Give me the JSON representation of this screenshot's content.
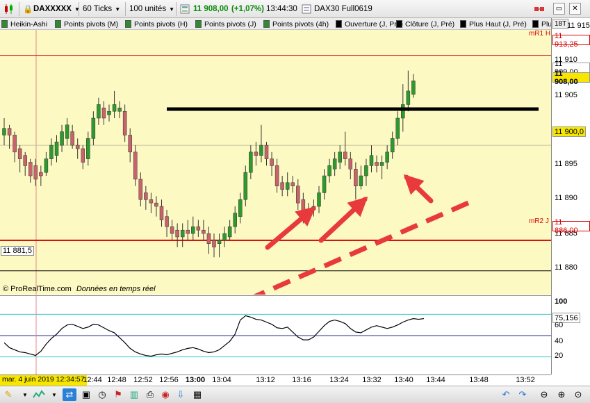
{
  "toolbar": {
    "symbol": "DAXXXXX",
    "ticks": "60 Ticks",
    "units": "100 unités",
    "price": "11 908,00",
    "change": "(+1,07%)",
    "time": "13:44:30",
    "contract": "DAX30 Full0619"
  },
  "indicators": [
    {
      "label": "Heikin-Ashi",
      "color": "#2e8b2e"
    },
    {
      "label": "Points pivots (M)",
      "color": "#2e8b2e"
    },
    {
      "label": "Points pivots (H)",
      "color": "#2e8b2e"
    },
    {
      "label": "Points pivots (J)",
      "color": "#2e8b2e"
    },
    {
      "label": "Points pivots (4h)",
      "color": "#2e8b2e"
    },
    {
      "label": "Ouverture (J, Pré)",
      "color": "#000000"
    },
    {
      "label": "Clôture (J, Pré)",
      "color": "#000000"
    },
    {
      "label": "Plus Haut (J, Pré)",
      "color": "#000000"
    },
    {
      "label": "Plu",
      "color": "#000000"
    }
  ],
  "price_pane": {
    "mr1_label": "mR1 H",
    "mr2_label": "mR2 J",
    "left_level": "11 881,5",
    "copyright": "© ProRealTime.com",
    "realtime": "Données en temps réel",
    "ticks_badge": "18T"
  },
  "price_axis": {
    "labels": [
      "11 915",
      "11 910",
      "11 905",
      "11 895",
      "11 890",
      "11 885",
      "11 880"
    ],
    "mr1_value": "11 913,25",
    "current_prev": "11 909,00",
    "current": "11 908,00",
    "level_11900": "11 900,0",
    "mr2_value": "11 886,00"
  },
  "osc_axis": {
    "labels": [
      "100",
      "60",
      "40",
      "20"
    ],
    "value": "75,156"
  },
  "time_axis": {
    "cursor_label": "mar. 4 juin 2019 12:34:57",
    "labels": [
      "12:44",
      "12:48",
      "12:52",
      "12:56",
      "13:00",
      "13:04",
      "13:12",
      "13:16",
      "13:24",
      "13:32",
      "13:40",
      "13:44",
      "13:48",
      "13:52"
    ]
  },
  "colors": {
    "bull": "#2e9a2e",
    "bear": "#c8636b",
    "pivot_line": "#d40000",
    "annot_red": "#e8393c",
    "pane_bg": "#fdf9c3"
  },
  "chart_data": {
    "type": "candlestick",
    "series_name": "Heikin-Ashi",
    "price_range": [
      11878,
      11917
    ],
    "candles": [
      {
        "o": 11901.5,
        "c": 11902.5,
        "h": 11904,
        "l": 11900
      },
      {
        "o": 11902.5,
        "c": 11901.5,
        "h": 11903,
        "l": 11899.5
      },
      {
        "o": 11901.5,
        "c": 11899,
        "h": 11902,
        "l": 11897.5
      },
      {
        "o": 11899.5,
        "c": 11898,
        "h": 11900,
        "l": 11896
      },
      {
        "o": 11898.5,
        "c": 11897,
        "h": 11899,
        "l": 11895.5
      },
      {
        "o": 11897.5,
        "c": 11895.5,
        "h": 11898,
        "l": 11894.5
      },
      {
        "o": 11897,
        "c": 11895,
        "h": 11898,
        "l": 11894
      },
      {
        "o": 11896,
        "c": 11895.5,
        "h": 11897,
        "l": 11894
      },
      {
        "o": 11896,
        "c": 11898,
        "h": 11899,
        "l": 11895.5
      },
      {
        "o": 11898,
        "c": 11900,
        "h": 11901,
        "l": 11897
      },
      {
        "o": 11898.5,
        "c": 11900.5,
        "h": 11901.5,
        "l": 11897.5
      },
      {
        "o": 11900,
        "c": 11902,
        "h": 11903,
        "l": 11899
      },
      {
        "o": 11901,
        "c": 11903,
        "h": 11904,
        "l": 11900
      },
      {
        "o": 11902,
        "c": 11900,
        "h": 11903,
        "l": 11899.5
      },
      {
        "o": 11900,
        "c": 11899.5,
        "h": 11901,
        "l": 11898
      },
      {
        "o": 11899.5,
        "c": 11897.5,
        "h": 11900,
        "l": 11896.5
      },
      {
        "o": 11898,
        "c": 11901,
        "h": 11902,
        "l": 11897
      },
      {
        "o": 11901,
        "c": 11904,
        "h": 11905,
        "l": 11900
      },
      {
        "o": 11904,
        "c": 11906,
        "h": 11907,
        "l": 11903
      },
      {
        "o": 11905.5,
        "c": 11904,
        "h": 11906.5,
        "l": 11903
      },
      {
        "o": 11904.5,
        "c": 11905,
        "h": 11906,
        "l": 11903.5
      },
      {
        "o": 11905,
        "c": 11906,
        "h": 11908,
        "l": 11904
      },
      {
        "o": 11905,
        "c": 11905.5,
        "h": 11906.5,
        "l": 11904
      },
      {
        "o": 11905,
        "c": 11901.5,
        "h": 11906,
        "l": 11900.5
      },
      {
        "o": 11901.5,
        "c": 11899,
        "h": 11902.5,
        "l": 11897.5
      },
      {
        "o": 11899,
        "c": 11895,
        "h": 11900,
        "l": 11894
      },
      {
        "o": 11895,
        "c": 11892,
        "h": 11896,
        "l": 11891
      },
      {
        "o": 11893,
        "c": 11892,
        "h": 11894,
        "l": 11890.5
      },
      {
        "o": 11892,
        "c": 11891.5,
        "h": 11893,
        "l": 11890
      },
      {
        "o": 11891.5,
        "c": 11891,
        "h": 11892.5,
        "l": 11889.5
      },
      {
        "o": 11891,
        "c": 11889,
        "h": 11892,
        "l": 11888
      },
      {
        "o": 11889.5,
        "c": 11888,
        "h": 11890.5,
        "l": 11886.5
      },
      {
        "o": 11888,
        "c": 11887,
        "h": 11889,
        "l": 11886
      },
      {
        "o": 11887.5,
        "c": 11886.5,
        "h": 11888.5,
        "l": 11885
      },
      {
        "o": 11886.5,
        "c": 11887.5,
        "h": 11888.5,
        "l": 11885
      },
      {
        "o": 11887.5,
        "c": 11887,
        "h": 11889,
        "l": 11886
      },
      {
        "o": 11887,
        "c": 11888,
        "h": 11889.5,
        "l": 11886
      },
      {
        "o": 11888,
        "c": 11887.5,
        "h": 11889,
        "l": 11886.5
      },
      {
        "o": 11887.5,
        "c": 11887,
        "h": 11889,
        "l": 11886
      },
      {
        "o": 11887,
        "c": 11885.5,
        "h": 11888,
        "l": 11884
      },
      {
        "o": 11886,
        "c": 11885,
        "h": 11887,
        "l": 11883.5
      },
      {
        "o": 11885.5,
        "c": 11886,
        "h": 11887,
        "l": 11883.5
      },
      {
        "o": 11886,
        "c": 11887,
        "h": 11888,
        "l": 11885
      },
      {
        "o": 11886.5,
        "c": 11888,
        "h": 11889,
        "l": 11886
      },
      {
        "o": 11888,
        "c": 11890,
        "h": 11891,
        "l": 11887
      },
      {
        "o": 11889.5,
        "c": 11892,
        "h": 11893,
        "l": 11888.5
      },
      {
        "o": 11892,
        "c": 11896,
        "h": 11897,
        "l": 11891
      },
      {
        "o": 11896,
        "c": 11899,
        "h": 11900,
        "l": 11895
      },
      {
        "o": 11899,
        "c": 11898.5,
        "h": 11900.5,
        "l": 11897
      },
      {
        "o": 11898.5,
        "c": 11900,
        "h": 11903,
        "l": 11897.5
      },
      {
        "o": 11900,
        "c": 11898,
        "h": 11900.5,
        "l": 11897
      },
      {
        "o": 11898,
        "c": 11897,
        "h": 11899,
        "l": 11895.5
      },
      {
        "o": 11897,
        "c": 11894,
        "h": 11898,
        "l": 11893
      },
      {
        "o": 11894.5,
        "c": 11893.5,
        "h": 11895.5,
        "l": 11892.5
      },
      {
        "o": 11893.5,
        "c": 11894.5,
        "h": 11896,
        "l": 11892.5
      },
      {
        "o": 11894.5,
        "c": 11894,
        "h": 11895.5,
        "l": 11893
      },
      {
        "o": 11894,
        "c": 11891.5,
        "h": 11895,
        "l": 11890.5
      },
      {
        "o": 11892,
        "c": 11890,
        "h": 11893,
        "l": 11888.5
      },
      {
        "o": 11890,
        "c": 11890.5,
        "h": 11891.5,
        "l": 11889
      },
      {
        "o": 11890.5,
        "c": 11891,
        "h": 11892,
        "l": 11889.5
      },
      {
        "o": 11891,
        "c": 11893,
        "h": 11894,
        "l": 11890
      },
      {
        "o": 11893,
        "c": 11895.5,
        "h": 11896.5,
        "l": 11892
      },
      {
        "o": 11895.5,
        "c": 11897,
        "h": 11898,
        "l": 11894.5
      },
      {
        "o": 11896.5,
        "c": 11898,
        "h": 11899,
        "l": 11895.5
      },
      {
        "o": 11897.5,
        "c": 11899,
        "h": 11900,
        "l": 11896.5
      },
      {
        "o": 11899,
        "c": 11898,
        "h": 11902,
        "l": 11897
      },
      {
        "o": 11898,
        "c": 11896.5,
        "h": 11899,
        "l": 11895
      },
      {
        "o": 11896.5,
        "c": 11894,
        "h": 11897.5,
        "l": 11892
      },
      {
        "o": 11894,
        "c": 11895.5,
        "h": 11897,
        "l": 11893.5
      },
      {
        "o": 11895.5,
        "c": 11897,
        "h": 11898,
        "l": 11894
      },
      {
        "o": 11897,
        "c": 11898.5,
        "h": 11900,
        "l": 11896
      },
      {
        "o": 11897.5,
        "c": 11897,
        "h": 11898.5,
        "l": 11896
      },
      {
        "o": 11897,
        "c": 11897.5,
        "h": 11898.5,
        "l": 11895
      },
      {
        "o": 11897.5,
        "c": 11899,
        "h": 11900,
        "l": 11896.5
      },
      {
        "o": 11899,
        "c": 11901,
        "h": 11902,
        "l": 11898
      },
      {
        "o": 11901,
        "c": 11904,
        "h": 11905,
        "l": 11900
      },
      {
        "o": 11904,
        "c": 11906,
        "h": 11909,
        "l": 11902
      },
      {
        "o": 11906,
        "c": 11908,
        "h": 11911,
        "l": 11905
      },
      {
        "o": 11907.5,
        "c": 11909.5,
        "h": 11910.5,
        "l": 11907
      }
    ],
    "pivot_levels": [
      {
        "name": "mR1 H",
        "value": 11913.25
      },
      {
        "name": "mR2 J",
        "value": 11886.0
      }
    ],
    "reference_levels": [
      11900.0,
      11881.5
    ],
    "oscillator": {
      "range": [
        0,
        100
      ],
      "current": 75.156,
      "levels": [
        80,
        50,
        20
      ],
      "values": [
        40,
        33,
        30,
        27,
        26,
        24,
        22,
        28,
        38,
        46,
        52,
        60,
        65,
        66,
        63,
        60,
        62,
        66,
        65,
        61,
        57,
        54,
        47,
        40,
        32,
        27,
        24,
        22,
        21,
        23,
        24,
        23,
        25,
        27,
        30,
        32,
        33,
        31,
        28,
        26,
        27,
        30,
        36,
        42,
        52,
        72,
        78,
        76,
        73,
        72,
        69,
        66,
        61,
        60,
        62,
        55,
        48,
        44,
        44,
        48,
        56,
        64,
        70,
        72,
        70,
        67,
        60,
        55,
        54,
        58,
        62,
        64,
        62,
        60,
        62,
        65,
        69,
        72,
        74,
        73,
        74
      ]
    }
  }
}
